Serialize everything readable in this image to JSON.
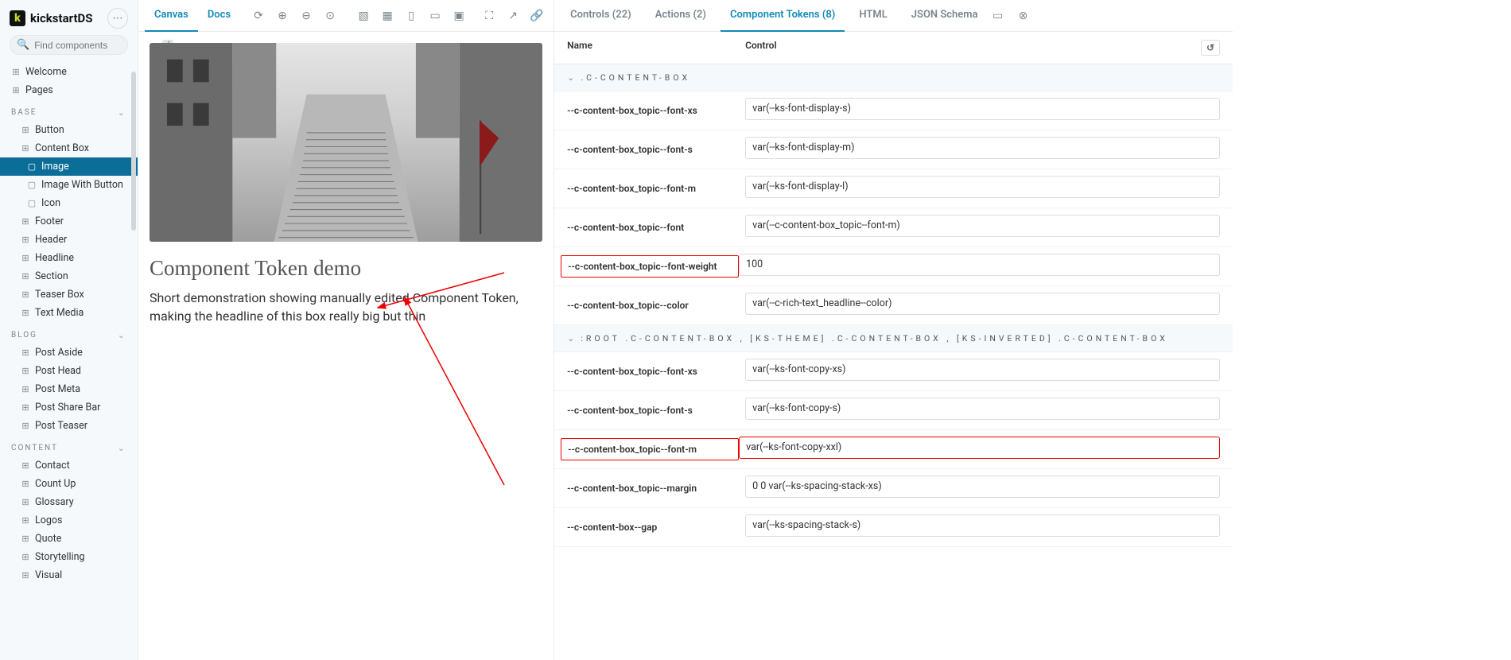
{
  "brand": "kickstartDS",
  "search": {
    "placeholder": "Find components",
    "shortcut": "/"
  },
  "sidebar": {
    "top": [
      {
        "icon": "⊞",
        "label": "Welcome"
      },
      {
        "icon": "⊞",
        "label": "Pages"
      }
    ],
    "groups": [
      {
        "name": "BASE",
        "items": [
          {
            "icon": "⊞",
            "label": "Button"
          },
          {
            "icon": "⊞",
            "label": "Content Box",
            "expanded": true,
            "children": [
              {
                "icon": "◻",
                "label": "Image",
                "active": true
              },
              {
                "icon": "◻",
                "label": "Image With Button"
              },
              {
                "icon": "◻",
                "label": "Icon"
              }
            ]
          },
          {
            "icon": "⊞",
            "label": "Footer"
          },
          {
            "icon": "⊞",
            "label": "Header"
          },
          {
            "icon": "⊞",
            "label": "Headline"
          },
          {
            "icon": "⊞",
            "label": "Section"
          },
          {
            "icon": "⊞",
            "label": "Teaser Box"
          },
          {
            "icon": "⊞",
            "label": "Text Media"
          }
        ]
      },
      {
        "name": "BLOG",
        "items": [
          {
            "icon": "⊞",
            "label": "Post Aside"
          },
          {
            "icon": "⊞",
            "label": "Post Head"
          },
          {
            "icon": "⊞",
            "label": "Post Meta"
          },
          {
            "icon": "⊞",
            "label": "Post Share Bar"
          },
          {
            "icon": "⊞",
            "label": "Post Teaser"
          }
        ]
      },
      {
        "name": "CONTENT",
        "items": [
          {
            "icon": "⊞",
            "label": "Contact"
          },
          {
            "icon": "⊞",
            "label": "Count Up"
          },
          {
            "icon": "⊞",
            "label": "Glossary"
          },
          {
            "icon": "⊞",
            "label": "Logos"
          },
          {
            "icon": "⊞",
            "label": "Quote"
          },
          {
            "icon": "⊞",
            "label": "Storytelling"
          },
          {
            "icon": "⊞",
            "label": "Visual"
          }
        ]
      }
    ]
  },
  "canvas": {
    "tabs": {
      "canvas": "Canvas",
      "docs": "Docs"
    },
    "preview": {
      "title": "Component Token demo",
      "body": "Short demonstration showing manually edited Component Token, making the headline of this box really big but thin"
    }
  },
  "addons": {
    "tabs": {
      "controls": "Controls (22)",
      "actions": "Actions (2)",
      "tokens": "Component Tokens (8)",
      "html": "HTML",
      "json": "JSON Schema"
    },
    "head": {
      "name": "Name",
      "control": "Control"
    },
    "sections": [
      {
        "name": ".C-CONTENT-BOX",
        "rows": [
          {
            "name": "--c-content-box_topic--font-xs",
            "value": "var(--ks-font-display-s)"
          },
          {
            "name": "--c-content-box_topic--font-s",
            "value": "var(--ks-font-display-m)"
          },
          {
            "name": "--c-content-box_topic--font-m",
            "value": "var(--ks-font-display-l)"
          },
          {
            "name": "--c-content-box_topic--font",
            "value": "var(--c-content-box_topic--font-m)"
          },
          {
            "name": "--c-content-box_topic--font-weight",
            "value": "100",
            "hl_name": true
          },
          {
            "name": "--c-content-box_topic--color",
            "value": "var(--c-rich-text_headline--color)"
          }
        ]
      },
      {
        "name": ":ROOT .C-CONTENT-BOX , [KS-THEME] .C-CONTENT-BOX , [KS-INVERTED] .C-CONTENT-BOX",
        "rows": [
          {
            "name": "--c-content-box_topic--font-xs",
            "value": "var(--ks-font-copy-xs)"
          },
          {
            "name": "--c-content-box_topic--font-s",
            "value": "var(--ks-font-copy-s)"
          },
          {
            "name": "--c-content-box_topic--font-m",
            "value": "var(--ks-font-copy-xxl)",
            "hl_both": true
          },
          {
            "name": "--c-content-box_topic--margin",
            "value": "0 0 var(--ks-spacing-stack-xs)"
          },
          {
            "name": "--c-content-box--gap",
            "value": "var(--ks-spacing-stack-s)"
          }
        ]
      }
    ]
  }
}
